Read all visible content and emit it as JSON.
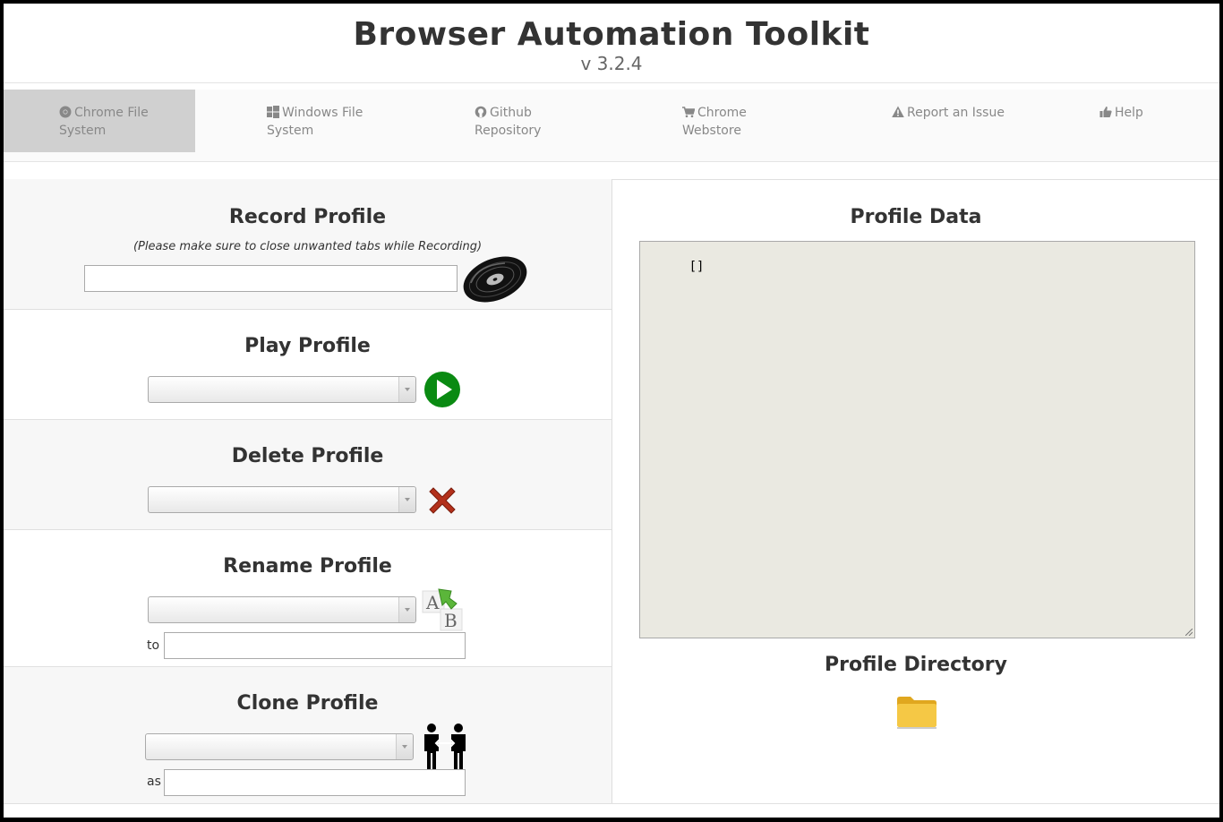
{
  "header": {
    "title": "Browser Automation Toolkit",
    "version": "v 3.2.4"
  },
  "nav": {
    "items": [
      {
        "label": "Chrome File System",
        "icon": "chrome-icon",
        "active": true
      },
      {
        "label": "Windows File System",
        "icon": "windows-icon",
        "active": false
      },
      {
        "label": "Github Repository",
        "icon": "github-icon",
        "active": false
      },
      {
        "label": "Chrome Webstore",
        "icon": "cart-icon",
        "active": false
      },
      {
        "label": "Report an Issue",
        "icon": "warning-icon",
        "active": false
      },
      {
        "label": "Help",
        "icon": "thumbs-up-icon",
        "active": false
      }
    ]
  },
  "record": {
    "title": "Record Profile",
    "hint": "(Please make sure to close unwanted tabs while Recording)",
    "name_value": ""
  },
  "play": {
    "title": "Play Profile",
    "selected": ""
  },
  "delete": {
    "title": "Delete Profile",
    "selected": ""
  },
  "rename": {
    "title": "Rename Profile",
    "selected": "",
    "to_label": "to",
    "to_value": ""
  },
  "clone": {
    "title": "Clone Profile",
    "selected": "",
    "as_label": "as",
    "as_value": ""
  },
  "profile_data": {
    "title": "Profile Data",
    "content": "[]"
  },
  "profile_directory": {
    "title": "Profile Directory"
  },
  "colors": {
    "play_green": "#0a8a12",
    "delete_red": "#b3301a",
    "folder_yellow": "#f2c23a",
    "nav_active_bg": "#d0d0d0",
    "data_area_bg": "#eae9e1"
  }
}
